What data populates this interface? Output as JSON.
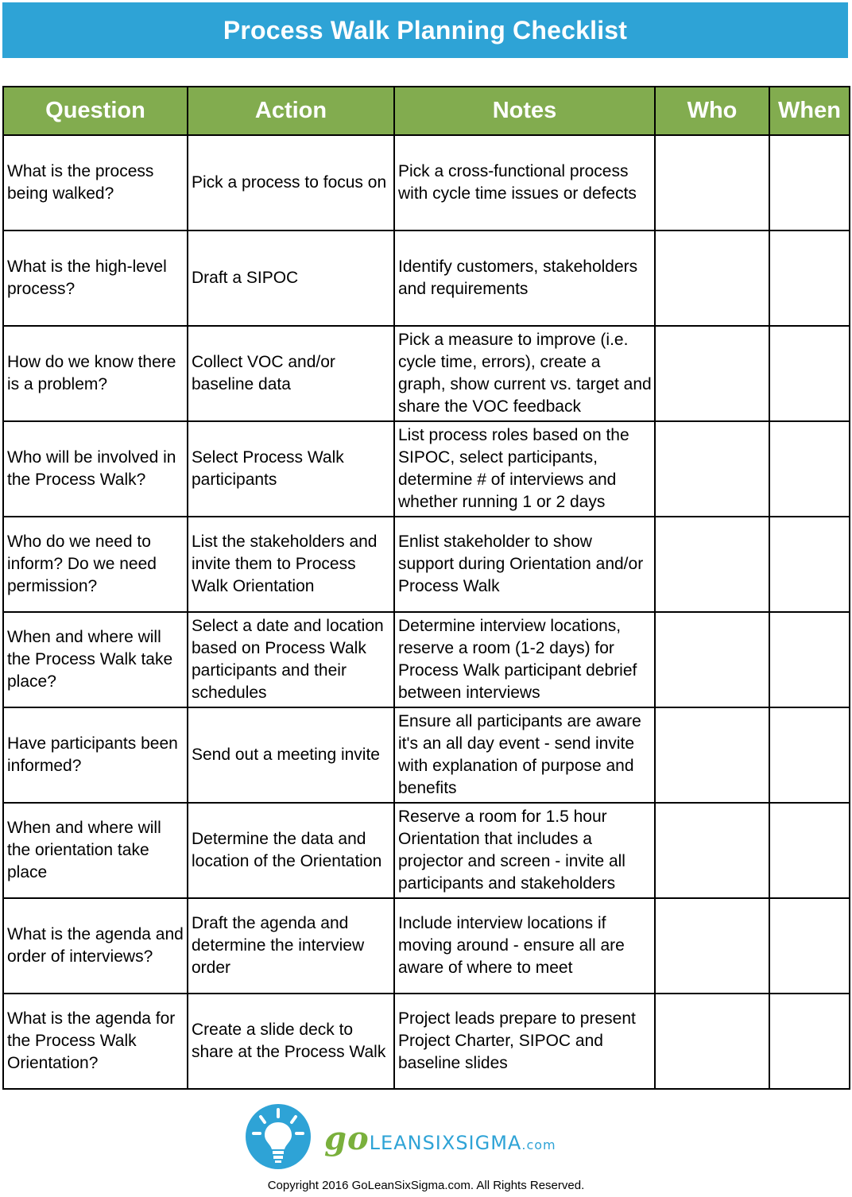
{
  "title": "Process Walk Planning Checklist",
  "colors": {
    "banner": "#2ea3d6",
    "header": "#82ac4f",
    "brand_green": "#7ab03c",
    "brand_blue": "#2ea3d6"
  },
  "table": {
    "headers": [
      "Question",
      "Action",
      "Notes",
      "Who",
      "When"
    ],
    "rows": [
      {
        "question": "What is the process being walked?",
        "action": "Pick a process to focus on",
        "notes": "Pick a cross-functional process with cycle time issues or defects",
        "who": "",
        "when": ""
      },
      {
        "question": "What is the high-level process?",
        "action": "Draft a SIPOC",
        "notes": "Identify customers, stakeholders and requirements",
        "who": "",
        "when": ""
      },
      {
        "question": "How do we know there is a problem?",
        "action": "Collect VOC and/or baseline data",
        "notes": "Pick a measure to improve (i.e. cycle time, errors), create a graph, show current vs. target and share the VOC feedback",
        "who": "",
        "when": ""
      },
      {
        "question": "Who will be involved in the Process Walk?",
        "action": "Select Process Walk participants",
        "notes": "List  process roles based on the SIPOC, select participants, determine # of interviews and whether running 1 or 2 days",
        "who": "",
        "when": ""
      },
      {
        "question": "Who do we need to inform? Do we need permission?",
        "action": "List the stakeholders and invite them to Process Walk Orientation",
        "notes": "Enlist stakeholder to show support during Orientation and/or Process Walk",
        "who": "",
        "when": ""
      },
      {
        "question": "When and where will the  Process Walk take place?",
        "action": "Select a date and location based on Process Walk participants and their schedules",
        "notes": "Determine interview locations, reserve a room (1-2 days) for Process Walk participant debrief between interviews",
        "who": "",
        "when": ""
      },
      {
        "question": "Have participants been informed?",
        "action": "Send out a meeting invite",
        "notes": "Ensure all participants are aware it's an all day event - send invite with explanation of purpose and benefits",
        "who": "",
        "when": ""
      },
      {
        "question": "When and where will the orientation take place",
        "action": "Determine the data and location of the Orientation",
        "notes": "Reserve a room for 1.5 hour Orientation that includes a projector and screen - invite all participants and stakeholders",
        "who": "",
        "when": ""
      },
      {
        "question": "What is the agenda and order of interviews?",
        "action": "Draft the agenda and determine the interview order",
        "notes": "Include interview locations if moving around - ensure all are aware of where to meet",
        "who": "",
        "when": ""
      },
      {
        "question": "What is the agenda for the Process Walk Orientation?",
        "action": "Create a slide deck to share at the Process Walk",
        "notes": "Project leads prepare to present Project Charter, SIPOC and baseline slides",
        "who": "",
        "when": ""
      }
    ]
  },
  "footer": {
    "logo_icon": "lightbulb-icon",
    "brand_go": "go",
    "brand_name": "LEANSIXSIGMA",
    "brand_tld": ".com",
    "copyright": "Copyright 2016 GoLeanSixSigma.com. All Rights Reserved."
  }
}
